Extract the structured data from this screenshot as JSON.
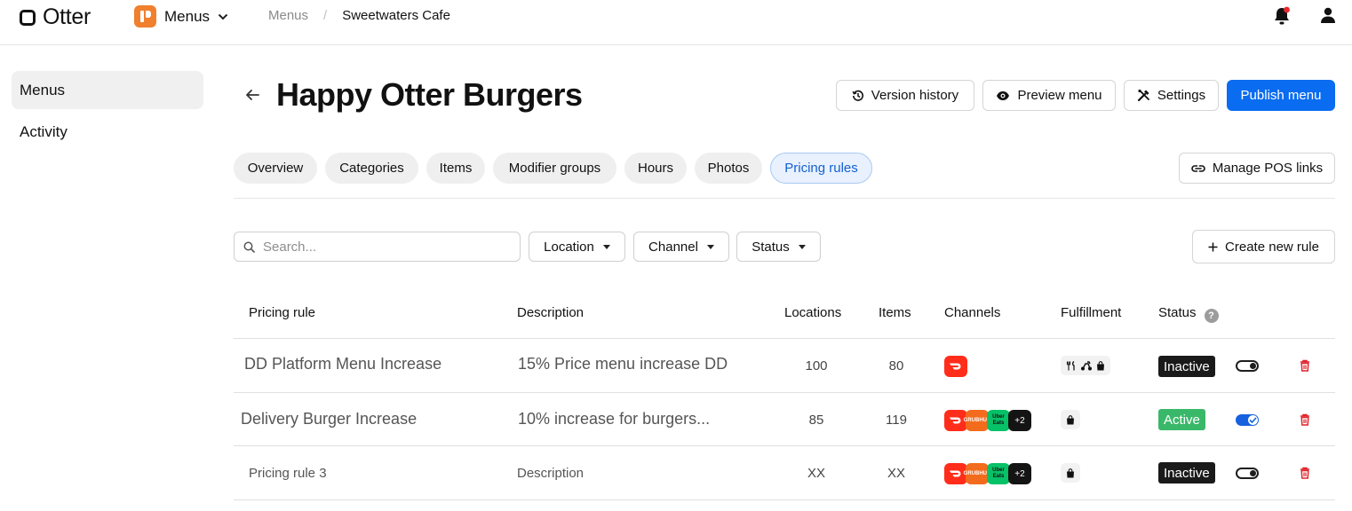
{
  "topbar": {
    "brand": "Otter",
    "app_name": "Menus",
    "breadcrumb": [
      "Menus",
      "Sweetwaters Cafe"
    ],
    "notification_dot_color": "#e8262b"
  },
  "sidebar": {
    "items": [
      {
        "label": "Menus",
        "active": true
      },
      {
        "label": "Activity",
        "active": false
      }
    ]
  },
  "header": {
    "title": "Happy Otter Burgers",
    "buttons": {
      "version_history": "Version history",
      "preview": "Preview menu",
      "settings": "Settings",
      "publish": "Publish menu"
    }
  },
  "tabs": [
    {
      "label": "Overview"
    },
    {
      "label": "Categories"
    },
    {
      "label": "Items"
    },
    {
      "label": "Modifier groups"
    },
    {
      "label": "Hours"
    },
    {
      "label": "Photos"
    },
    {
      "label": "Pricing rules",
      "active": true
    }
  ],
  "manage_pos_links": "Manage POS links",
  "filters": {
    "search_placeholder": "Search...",
    "location": "Location",
    "channel": "Channel",
    "status": "Status",
    "create_rule": "Create new rule"
  },
  "table": {
    "columns": {
      "rule": "Pricing rule",
      "description": "Description",
      "locations": "Locations",
      "items": "Items",
      "channels": "Channels",
      "fulfillment": "Fulfillment",
      "status": "Status"
    },
    "rows": [
      {
        "rule": "DD Platform Menu Increase",
        "description": "15% Price menu increase DD",
        "locations": "100",
        "items": "80",
        "channels": [
          "doordash-icon"
        ],
        "fulfillment": [
          "dine-in-icon",
          "delivery-icon",
          "pickup-bag-icon"
        ],
        "status": "Inactive",
        "enabled": false
      },
      {
        "rule": "Delivery Burger Increase",
        "description": "10% increase for burgers...",
        "locations": "85",
        "items": "119",
        "channels": [
          "doordash-icon",
          "grubhub-icon",
          "ubereats-icon"
        ],
        "channels_more": "+2",
        "ubereats_text": "Uber Eats",
        "grubhub_text": "GRUBHUB",
        "fulfillment": [
          "pickup-bag-icon"
        ],
        "status": "Active",
        "enabled": true
      },
      {
        "rule": "Pricing rule 3",
        "description": "Description",
        "locations": "XX",
        "items": "XX",
        "channels": [
          "doordash-icon",
          "grubhub-icon",
          "ubereats-icon"
        ],
        "channels_more": "+2",
        "ubereats_text": "Uber Eats",
        "grubhub_text": "GRUBHUB",
        "fulfillment": [
          "pickup-bag-icon"
        ],
        "status": "Inactive",
        "enabled": false
      }
    ]
  },
  "colors": {
    "primary": "#0a6cf0",
    "active_tab_text": "#1560d0",
    "active_badge": "#3ab86a",
    "inactive_badge": "#1a1a1a",
    "delete": "#e0242c"
  }
}
